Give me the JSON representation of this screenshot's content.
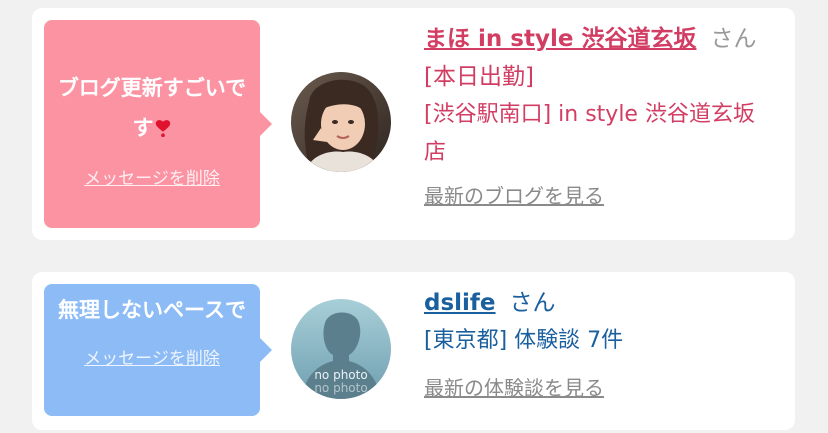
{
  "cards": [
    {
      "bubble_color": "#fc93a3",
      "message": "ブログ更新すごいです",
      "message_emoji": "heart-exclamation",
      "delete_label": "メッセージを削除",
      "name": "まほ in style 渋谷道玄坂",
      "honorific": "さん",
      "name_suffix": "[本日出勤]",
      "detail": "[渋谷駅南口] in style 渋谷道玄坂店",
      "link_label": "最新のブログを見る",
      "text_color": "#d23d63"
    },
    {
      "bubble_color": "#8cbbf6",
      "message": "無理しないペースで",
      "delete_label": "メッセージを削除",
      "name": "dslife",
      "honorific": "さん",
      "detail": "[東京都] 体験談 7件",
      "link_label": "最新の体験談を見る",
      "avatar_text_1": "no photo",
      "avatar_text_2": "no photo",
      "text_color": "#1a5f9e"
    }
  ]
}
